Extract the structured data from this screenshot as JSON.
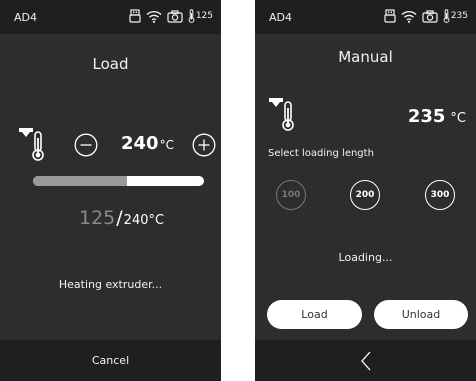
{
  "left": {
    "status": {
      "title": "AD4",
      "temp": "125"
    },
    "title": "Load",
    "target_temp": "240",
    "target_unit": "°C",
    "progress": 0.55,
    "current_temp": "125",
    "slash": "/",
    "current_target": "240°C",
    "status_text": "Heating extruder...",
    "cancel_label": "Cancel"
  },
  "right": {
    "status": {
      "title": "AD4",
      "temp": "235"
    },
    "title": "Manual",
    "temp_value": "235",
    "temp_unit": "°C",
    "select_label": "Select loading length",
    "lengths": [
      "100",
      "200",
      "300"
    ],
    "status_text": "Loading...",
    "load_label": "Load",
    "unload_label": "Unload"
  },
  "icons": [
    "usb-icon",
    "wifi-icon",
    "camera-icon",
    "thermometer-icon",
    "minus-icon",
    "plus-icon",
    "back-chevron-icon"
  ],
  "colors": {
    "screen_bg": "#2d2d2d",
    "bar_bg": "#1f1f1f",
    "progress_fill": "#9a9a9a",
    "inactive": "#777777",
    "pill_bg": "#ffffff"
  }
}
